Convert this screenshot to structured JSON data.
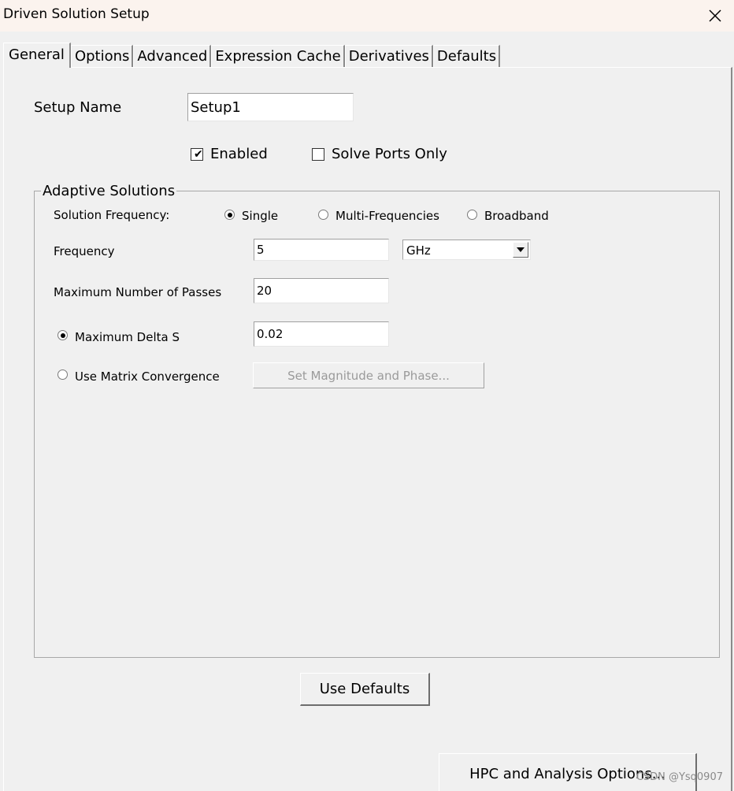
{
  "window": {
    "title": "Driven Solution Setup"
  },
  "tabs": [
    {
      "label": "General",
      "active": true
    },
    {
      "label": "Options",
      "active": false
    },
    {
      "label": "Advanced",
      "active": false
    },
    {
      "label": "Expression Cache",
      "active": false
    },
    {
      "label": "Derivatives",
      "active": false
    },
    {
      "label": "Defaults",
      "active": false
    }
  ],
  "general": {
    "setup_name_label": "Setup Name",
    "setup_name_value": "Setup1",
    "enabled_label": "Enabled",
    "enabled_checked": true,
    "solve_ports_only_label": "Solve Ports Only",
    "solve_ports_only_checked": false
  },
  "adaptive": {
    "legend": "Adaptive Solutions",
    "solution_frequency_label": "Solution Frequency:",
    "radio_single": "Single",
    "radio_multi": "Multi-Frequencies",
    "radio_broadband": "Broadband",
    "selected_mode": "Single",
    "frequency_label": "Frequency",
    "frequency_value": "5",
    "frequency_unit": "GHz",
    "max_passes_label": "Maximum Number of Passes",
    "max_passes_value": "20",
    "max_delta_s_label": "Maximum Delta S",
    "max_delta_s_value": "0.02",
    "use_matrix_label": "Use Matrix Convergence",
    "convergence_selected": "Maximum Delta S",
    "set_mag_phase_label": "Set Magnitude and Phase..."
  },
  "buttons": {
    "use_defaults": "Use Defaults",
    "hpc_options": "HPC and Analysis Options..."
  },
  "watermark": "CSDN @Ysq0907"
}
